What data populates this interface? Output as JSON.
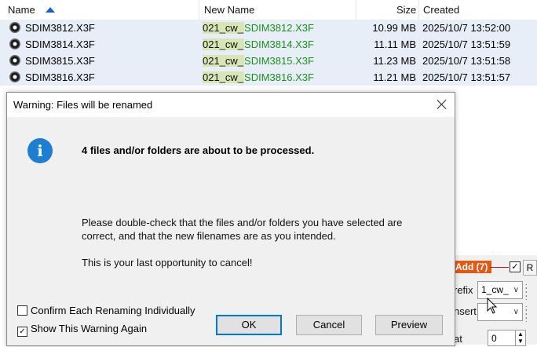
{
  "list": {
    "columns": [
      "Name",
      "New Name",
      "Size",
      "Created"
    ],
    "rows": [
      {
        "name": "SDIM3812.X3F",
        "prefix": "021_cw_",
        "base": "SDIM3812.X3F",
        "size": "10.99 MB",
        "created": "2025/10/7 13:52:00"
      },
      {
        "name": "SDIM3814.X3F",
        "prefix": "021_cw_",
        "base": "SDIM3814.X3F",
        "size": "11.11 MB",
        "created": "2025/10/7 13:51:59"
      },
      {
        "name": "SDIM3815.X3F",
        "prefix": "021_cw_",
        "base": "SDIM3815.X3F",
        "size": "11.23 MB",
        "created": "2025/10/7 13:51:58"
      },
      {
        "name": "SDIM3816.X3F",
        "prefix": "021_cw_",
        "base": "SDIM3816.X3F",
        "size": "11.21 MB",
        "created": "2025/10/7 13:51:57"
      }
    ]
  },
  "panel": {
    "add_label": "Add (7)",
    "add_check": "✓",
    "r_label": "R",
    "prefix_label": "refix",
    "prefix_value": "1_cw_",
    "insert_label": "nsert",
    "at_label": "at",
    "at_value": "0"
  },
  "dialog": {
    "title": "Warning: Files will be renamed",
    "main_message": "4 files and/or folders are about to be processed.",
    "detail_line1": "Please double-check that the files and/or folders you have selected are",
    "detail_line2": "correct, and that the new filenames are as you intended.",
    "detail_line3": "This is your last opportunity to cancel!",
    "option_confirm": "Confirm Each Renaming Individually",
    "option_confirm_checked": false,
    "option_show": "Show This Warning Again",
    "option_show_checked": true,
    "check_mark": "✓",
    "ok_label": "OK",
    "cancel_label": "Cancel",
    "preview_label": "Preview"
  },
  "colors": {
    "accent": "#0078d7",
    "row_selected": "#e8eef8",
    "new_name_green": "#1b8f1b",
    "prefix_highlight": "#d7e6b4",
    "add_button": "#e25a14",
    "info_icon": "#1c7fd1"
  }
}
